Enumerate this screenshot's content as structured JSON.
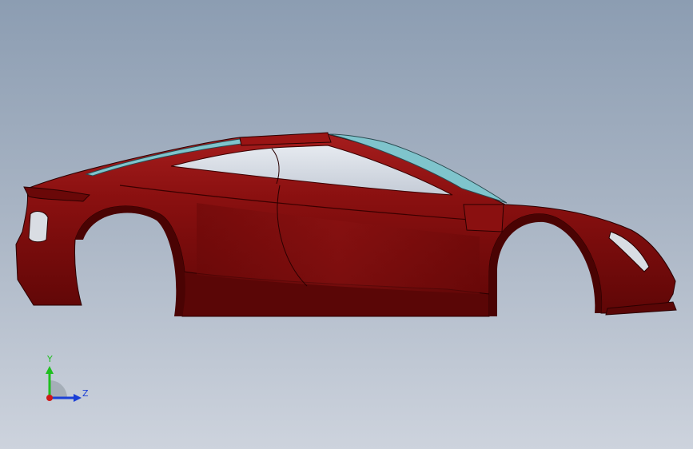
{
  "viewport": {
    "background_top": "#8c9db2",
    "background_bottom": "#cdd3dd"
  },
  "model": {
    "description_icon": "car-body-shell",
    "body_color": "#7a0b0b",
    "body_highlight": "#b82a2a",
    "body_shadow": "#4a0303",
    "glass_color": "#7fc4cc",
    "interior_color": "#d9dde3"
  },
  "triad": {
    "y_label": "Y",
    "z_label": "Z",
    "y_color": "#1fbf1f",
    "z_color": "#1a3fd6",
    "x_color": "#d01818"
  }
}
